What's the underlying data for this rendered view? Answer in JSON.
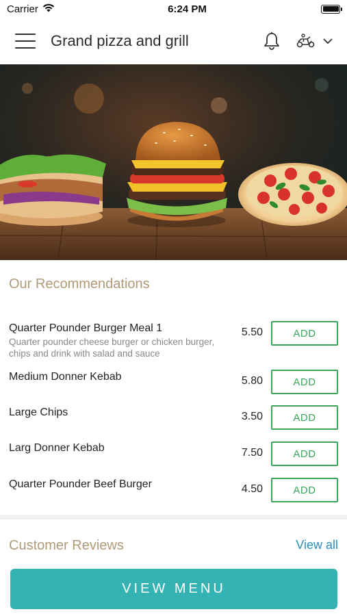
{
  "status_bar": {
    "carrier": "Carrier",
    "time": "6:24 PM"
  },
  "header": {
    "title": "Grand pizza and grill",
    "icons": [
      "menu-icon",
      "bell-icon",
      "delivery-scooter-icon",
      "chevron-down-icon"
    ]
  },
  "hero": {
    "alt": "burgers, kebab and pizza banner"
  },
  "recommendations": {
    "title": "Our Recommendations",
    "items": [
      {
        "name": "Quarter Pounder Burger Meal 1",
        "description": "Quarter pounder cheese burger or chicken burger, chips and drink with salad and sauce",
        "price": "5.50",
        "button": "ADD"
      },
      {
        "name": "Medium Donner Kebab",
        "description": "",
        "price": "5.80",
        "button": "ADD"
      },
      {
        "name": "Large Chips",
        "description": "",
        "price": "3.50",
        "button": "ADD"
      },
      {
        "name": "Larg Donner Kebab",
        "description": "",
        "price": "7.50",
        "button": "ADD"
      },
      {
        "name": "Quarter Pounder Beef Burger",
        "description": "",
        "price": "4.50",
        "button": "ADD"
      }
    ]
  },
  "reviews": {
    "title": "Customer Reviews",
    "view_all": "View all"
  },
  "footer": {
    "view_menu": "VIEW MENU"
  },
  "colors": {
    "accent_teal": "#35b3b3",
    "add_green": "#3aa55a",
    "section_title": "#b09a78",
    "link_blue": "#2a8fbf"
  }
}
